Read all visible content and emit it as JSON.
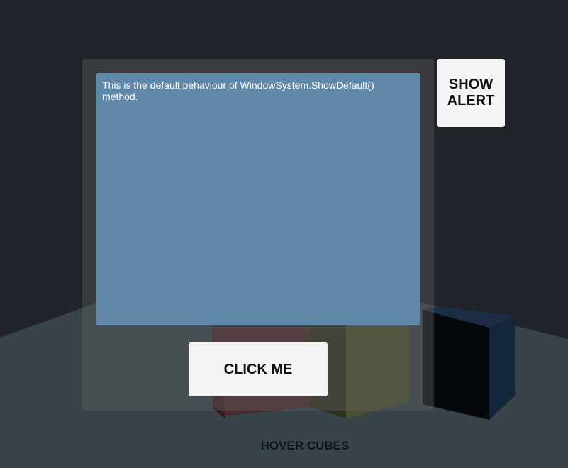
{
  "text_area": {
    "text": "This is the default behaviour of WindowSystem.ShowDefault() method."
  },
  "buttons": {
    "show_alert_label": "SHOW ALERT",
    "click_me_label": "CLICK ME"
  },
  "scene_label": "HOVER CUBES",
  "colors": {
    "background": "#21242b",
    "floor": "#38444a",
    "panel": "#5f5f5f",
    "text_area": "#5f88a9",
    "button": "#f4f4f4",
    "cube_red": "#4a2a2c",
    "cube_olive": "#4a5030",
    "cube_navy": "#15253a"
  }
}
